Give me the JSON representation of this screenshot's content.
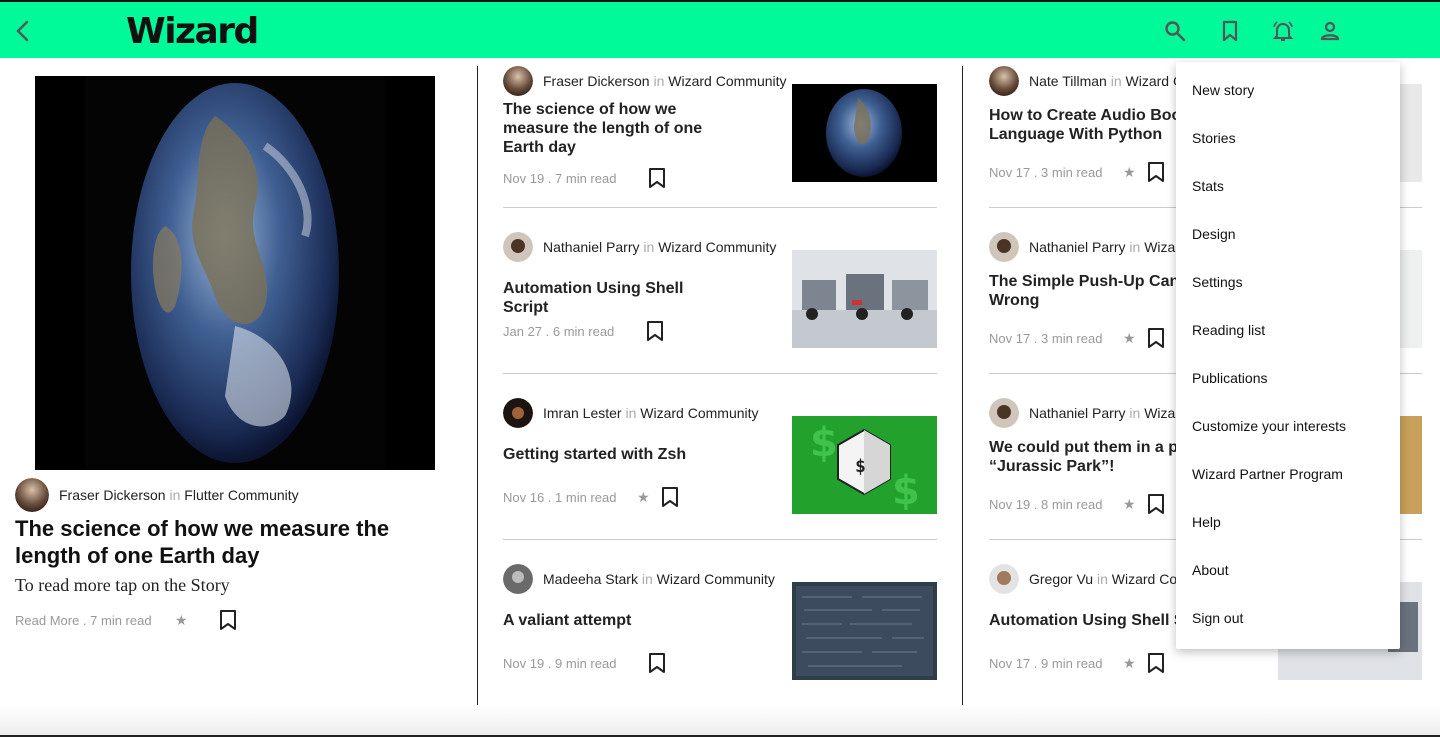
{
  "header": {
    "brand": "Wizard",
    "accent_color": "#00fa9a",
    "icons": [
      "back-arrow-icon",
      "search-icon",
      "bookmark-icon",
      "notification-bell-icon",
      "account-icon"
    ]
  },
  "featured": {
    "author": "Fraser Dickerson",
    "in_word": "in",
    "publication": "Flutter Community",
    "title": "The science of how we measure the length of one Earth day",
    "subtitle": "To read more tap on the Story",
    "meta": "Read More . 7 min read"
  },
  "column2": [
    {
      "author": "Fraser Dickerson",
      "in_word": "in",
      "publication": "Wizard Community",
      "title": "The science of how we measure the length of one Earth day",
      "meta": "Nov 19 . 7 min read",
      "thumb": "earth"
    },
    {
      "author": "Nathaniel Parry",
      "in_word": "in",
      "publication": "Wizard Community",
      "title": "Automation Using Shell Script",
      "meta": "Jan 27 . 6 min read",
      "thumb": "robots"
    },
    {
      "author": "Imran Lester",
      "in_word": "in",
      "publication": "Wizard Community",
      "title": "Getting started with Zsh",
      "meta": "Nov 16 . 1 min read",
      "thumb": "bash"
    },
    {
      "author": "Madeeha Stark",
      "in_word": "in",
      "publication": "Wizard Community",
      "title": "A valiant attempt",
      "meta": "Nov 19 . 9 min read",
      "thumb": "chalkboard"
    }
  ],
  "column3": [
    {
      "author": "Nate Tillman",
      "in_word": "in",
      "publication": "Wizard Community",
      "title": "How to Create Audio Books in Any Language With Python",
      "meta": "Nov 17 . 3 min read"
    },
    {
      "author": "Nathaniel Parry",
      "in_word": "in",
      "publication": "Wizard Community",
      "title": "The Simple Push-Up Can Go Terribly Wrong",
      "meta": "Nov 17 . 3 min read"
    },
    {
      "author": "Nathaniel Parry",
      "in_word": "in",
      "publication": "Wizard Community",
      "title": "We could put them in a park. Call it “Jurassic Park”!",
      "meta": "Nov 19 . 8 min read"
    },
    {
      "author": "Gregor Vu",
      "in_word": "in",
      "publication": "Wizard Community",
      "title": "Automation Using Shell Script",
      "meta": "Nov 17 . 9 min read"
    }
  ],
  "menu": {
    "items": [
      "New story",
      "Stories",
      "Stats",
      "Design",
      "Settings",
      "Reading list",
      "Publications",
      "Customize your interests",
      "Wizard Partner Program",
      "Help",
      "About",
      "Sign out"
    ]
  }
}
